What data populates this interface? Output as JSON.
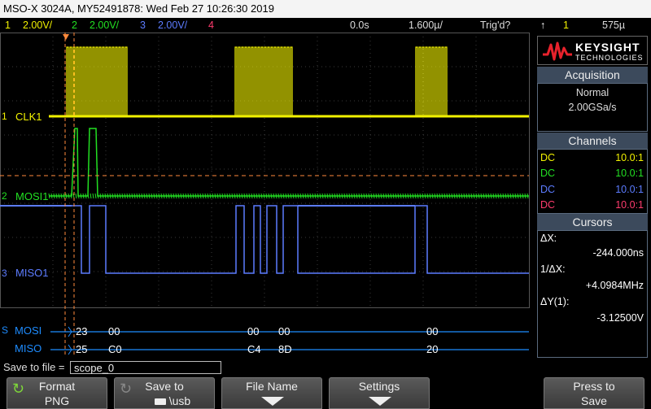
{
  "title": "MSO-X 3024A, MY52491878: Wed Feb 27 10:26:30 2019",
  "status": {
    "ch1_num": "1",
    "ch1_scale": "2.00V/",
    "ch2_num": "2",
    "ch2_scale": "2.00V/",
    "ch3_num": "3",
    "ch3_scale": "2.00V/",
    "ch4_num": "4",
    "delay": "0.0s",
    "timebase": "1.600µ/",
    "trigger_state": "Trig'd?",
    "trigger_source": "1",
    "trigger_level": "575µ"
  },
  "traces": {
    "clk_label": "CLK1",
    "mosi_label": "MOSI1",
    "miso_label": "MISO1",
    "serial_mosi_label": "MOSI",
    "serial_miso_label": "MISO",
    "mosi_bytes": [
      "23",
      "00",
      "00",
      "00",
      "00"
    ],
    "miso_bytes": [
      "25",
      "C0",
      "C4",
      "8D",
      "20"
    ]
  },
  "brand": {
    "line1": "KEYSIGHT",
    "line2": "TECHNOLOGIES"
  },
  "acquisition": {
    "header": "Acquisition",
    "mode": "Normal",
    "rate": "2.00GSa/s"
  },
  "channels": {
    "header": "Channels",
    "rows": [
      {
        "coupling": "DC",
        "probe": "10.0:1",
        "color": "#f2f200"
      },
      {
        "coupling": "DC",
        "probe": "10.0:1",
        "color": "#22e022"
      },
      {
        "coupling": "DC",
        "probe": "10.0:1",
        "color": "#5c7cff"
      },
      {
        "coupling": "DC",
        "probe": "10.0:1",
        "color": "#ff3c6e"
      }
    ]
  },
  "cursors": {
    "header": "Cursors",
    "dx_label": "ΔX:",
    "dx_value": "-244.000ns",
    "inv_dx_label": "1/ΔX:",
    "inv_dx_value": "+4.0984MHz",
    "dy_label": "ΔY(1):",
    "dy_value": "-3.12500V"
  },
  "save_to_file": {
    "label": "Save to file =",
    "value": "scope_0"
  },
  "softkeys": {
    "format_label": "Format",
    "format_value": "PNG",
    "save_to_label": "Save to",
    "save_to_value": "\\usb",
    "file_name_label": "File Name",
    "settings_label": "Settings",
    "press_to_label": "Press to",
    "press_to_value": "Save"
  },
  "colors": {
    "ch1": "#f2f200",
    "ch2": "#22e022",
    "ch3": "#5c7cff",
    "ch4": "#ff3c6e",
    "bus": "#1e8cff"
  }
}
